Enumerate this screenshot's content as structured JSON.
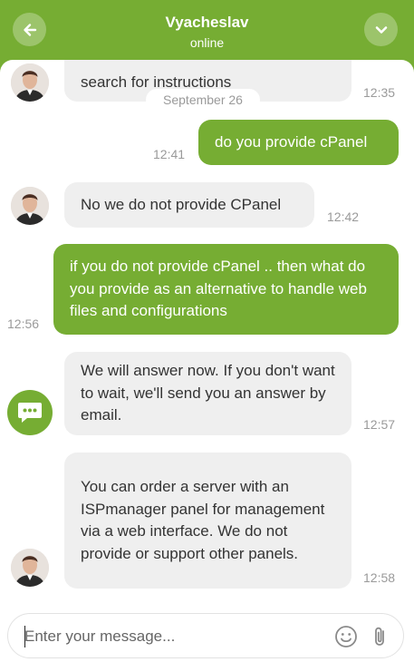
{
  "header": {
    "title": "Vyacheslav",
    "status": "online",
    "back_icon": "arrow-left-icon",
    "collapse_icon": "chevron-down-icon"
  },
  "chat": {
    "date_separator": "September 26",
    "messages": [
      {
        "from": "agent",
        "text": "search for instructions",
        "time": "12:35"
      },
      {
        "from": "user",
        "text": "do you provide cPanel",
        "time": "12:41"
      },
      {
        "from": "agent",
        "text": "No we do not provide CPanel",
        "time": "12:42"
      },
      {
        "from": "user",
        "text": "if you do not provide cPanel .. then what do you provide as an alternative to handle web files and configurations",
        "time": "12:56"
      },
      {
        "from": "bot",
        "text": "We will answer now. If you don't want to wait, we'll send you an answer by email.",
        "time": "12:57"
      },
      {
        "from": "agent",
        "text": "You can order a server with an ISPmanager panel for management via a web interface. We do not provide or support other panels.",
        "time": "12:58"
      }
    ]
  },
  "composer": {
    "placeholder": "Enter your message...",
    "emoji_icon": "emoji-icon",
    "attach_icon": "paperclip-icon"
  },
  "colors": {
    "accent": "#76ad33",
    "incoming_bubble": "#efefef",
    "timestamp": "#9a9a9a"
  }
}
